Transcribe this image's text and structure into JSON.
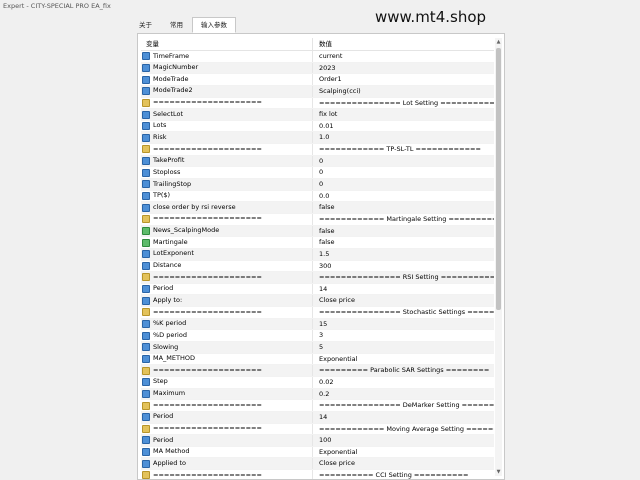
{
  "window": {
    "title": "Expert - CITY-SPECIAL PRO EA_fix"
  },
  "watermark": "www.mt4.shop",
  "tabs": [
    {
      "label": "关于"
    },
    {
      "label": "常用"
    },
    {
      "label": "输入参数"
    }
  ],
  "active_tab": 2,
  "table": {
    "headers": {
      "variable": "变量",
      "value": "数值"
    },
    "rows": [
      {
        "icon": "param-icon",
        "name": "TimeFrame",
        "value": "current"
      },
      {
        "icon": "param-icon",
        "name": "MagicNumber",
        "value": "2023"
      },
      {
        "icon": "param-icon",
        "name": "ModeTrade",
        "value": "Order1"
      },
      {
        "icon": "param-icon",
        "name": "ModeTrade2",
        "value": "Scalping(cci)"
      },
      {
        "icon": "separator-icon",
        "name": "====================",
        "value": "=============== Lot Setting =========="
      },
      {
        "icon": "param-icon",
        "name": "SelectLot",
        "value": "fix lot"
      },
      {
        "icon": "param-icon",
        "name": "Lots",
        "value": "0.01"
      },
      {
        "icon": "param-icon",
        "name": "Risk",
        "value": "1.0"
      },
      {
        "icon": "separator-icon",
        "name": "====================",
        "value": "============ TP-SL-TL ============"
      },
      {
        "icon": "param-icon",
        "name": "TakeProfit",
        "value": "0"
      },
      {
        "icon": "param-icon",
        "name": "Stoploss",
        "value": "0"
      },
      {
        "icon": "param-icon",
        "name": "TrailingStop",
        "value": "0"
      },
      {
        "icon": "param-icon",
        "name": "TP($)",
        "value": "0.0"
      },
      {
        "icon": "param-icon",
        "name": "close order by rsi reverse",
        "value": "false"
      },
      {
        "icon": "separator-icon",
        "name": "====================",
        "value": "============ Martingale Setting =========="
      },
      {
        "icon": "ma-icon",
        "name": "News_ScalpingMode",
        "value": "false"
      },
      {
        "icon": "ma-icon",
        "name": "Martingale",
        "value": "false"
      },
      {
        "icon": "param-icon",
        "name": "LotExponent",
        "value": "1.5"
      },
      {
        "icon": "param-icon",
        "name": "Distance",
        "value": "300"
      },
      {
        "icon": "separator-icon",
        "name": "====================",
        "value": "=============== RSI Setting =========="
      },
      {
        "icon": "param-icon",
        "name": "Period",
        "value": "14"
      },
      {
        "icon": "param-icon",
        "name": "Apply to:",
        "value": "Close price"
      },
      {
        "icon": "separator-icon",
        "name": "====================",
        "value": "=============== Stochastic Settings ======"
      },
      {
        "icon": "param-icon",
        "name": "%K period",
        "value": "15"
      },
      {
        "icon": "param-icon",
        "name": "%D period",
        "value": "3"
      },
      {
        "icon": "param-icon",
        "name": "Slowing",
        "value": "5"
      },
      {
        "icon": "param-icon",
        "name": "MA_METHOD",
        "value": "Exponential"
      },
      {
        "icon": "separator-icon",
        "name": "====================",
        "value": "========= Parabolic SAR Settings ========"
      },
      {
        "icon": "param-icon",
        "name": "Step",
        "value": "0.02"
      },
      {
        "icon": "param-icon",
        "name": "Maximum",
        "value": "0.2"
      },
      {
        "icon": "separator-icon",
        "name": "====================",
        "value": "=============== DeMarker Setting ======"
      },
      {
        "icon": "param-icon",
        "name": "Period",
        "value": "14"
      },
      {
        "icon": "separator-icon",
        "name": "====================",
        "value": "============ Moving Average Setting ======"
      },
      {
        "icon": "param-icon",
        "name": "Period",
        "value": "100"
      },
      {
        "icon": "param-icon",
        "name": "MA Method",
        "value": "Exponential"
      },
      {
        "icon": "param-icon",
        "name": "Applied to",
        "value": "Close price"
      },
      {
        "icon": "separator-icon",
        "name": "====================",
        "value": "========== CCI Setting =========="
      }
    ]
  },
  "colors": {
    "param_icon": "#4d8fd6",
    "separator_icon": "#e3c25a",
    "ma_icon": "#5dbb6a"
  }
}
